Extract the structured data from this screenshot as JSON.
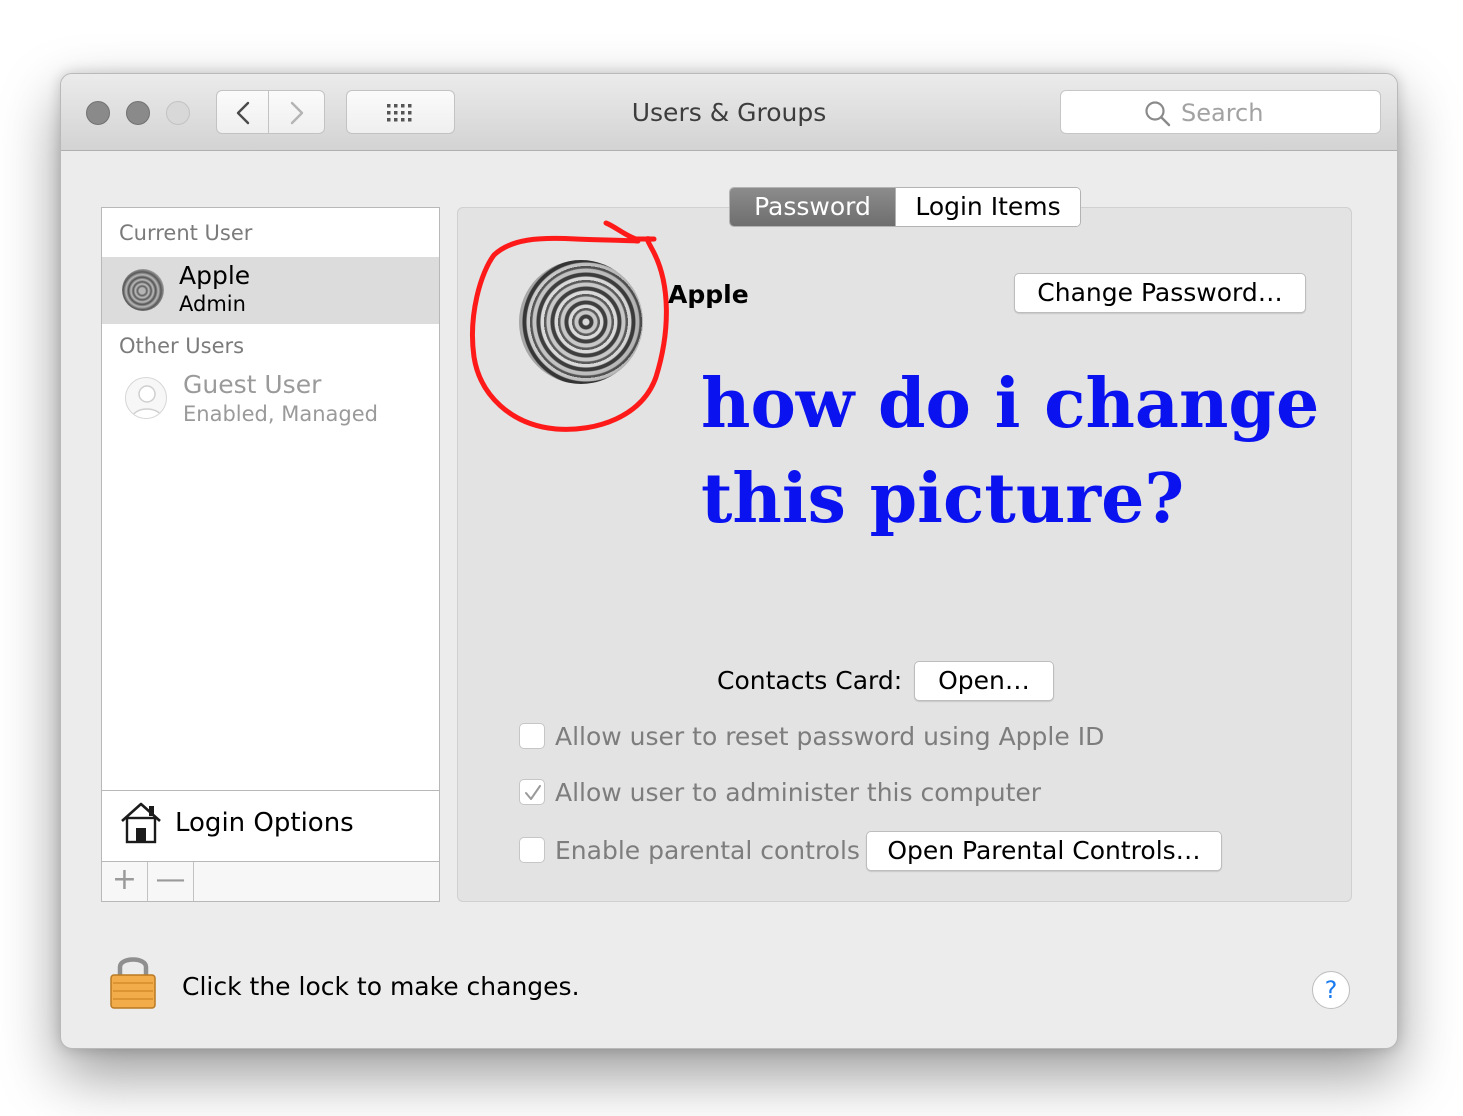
{
  "window": {
    "title": "Users & Groups"
  },
  "toolbar": {
    "back_icon": "chevron-left-icon",
    "forward_icon": "chevron-right-icon",
    "show_all_icon": "grid-icon",
    "search_placeholder": "Search"
  },
  "sidebar": {
    "current_user_header": "Current User",
    "current_user": {
      "name": "Apple",
      "role": "Admin",
      "selected": true
    },
    "other_users_header": "Other Users",
    "other_users": [
      {
        "name": "Guest User",
        "status": "Enabled, Managed"
      }
    ],
    "login_options_label": "Login Options",
    "add_button": "+",
    "remove_button": "—"
  },
  "panel": {
    "tabs": [
      {
        "label": "Password",
        "active": true
      },
      {
        "label": "Login Items",
        "active": false
      }
    ],
    "account_name": "Apple",
    "change_password_button": "Change Password…",
    "contacts_card_label": "Contacts Card:",
    "open_button": "Open…",
    "checkboxes": [
      {
        "label": "Allow user to reset password using Apple ID",
        "checked": false
      },
      {
        "label": "Allow user to administer this computer",
        "checked": true
      },
      {
        "label": "Enable parental controls",
        "checked": false
      }
    ],
    "parental_controls_button": "Open Parental Controls…"
  },
  "annotation": {
    "line1": "how do i change",
    "line2": "this picture?",
    "text_color": "#0a12f0",
    "circle_color": "#ff0000"
  },
  "footer": {
    "lock_text": "Click the lock to make changes.",
    "help_label": "?"
  }
}
